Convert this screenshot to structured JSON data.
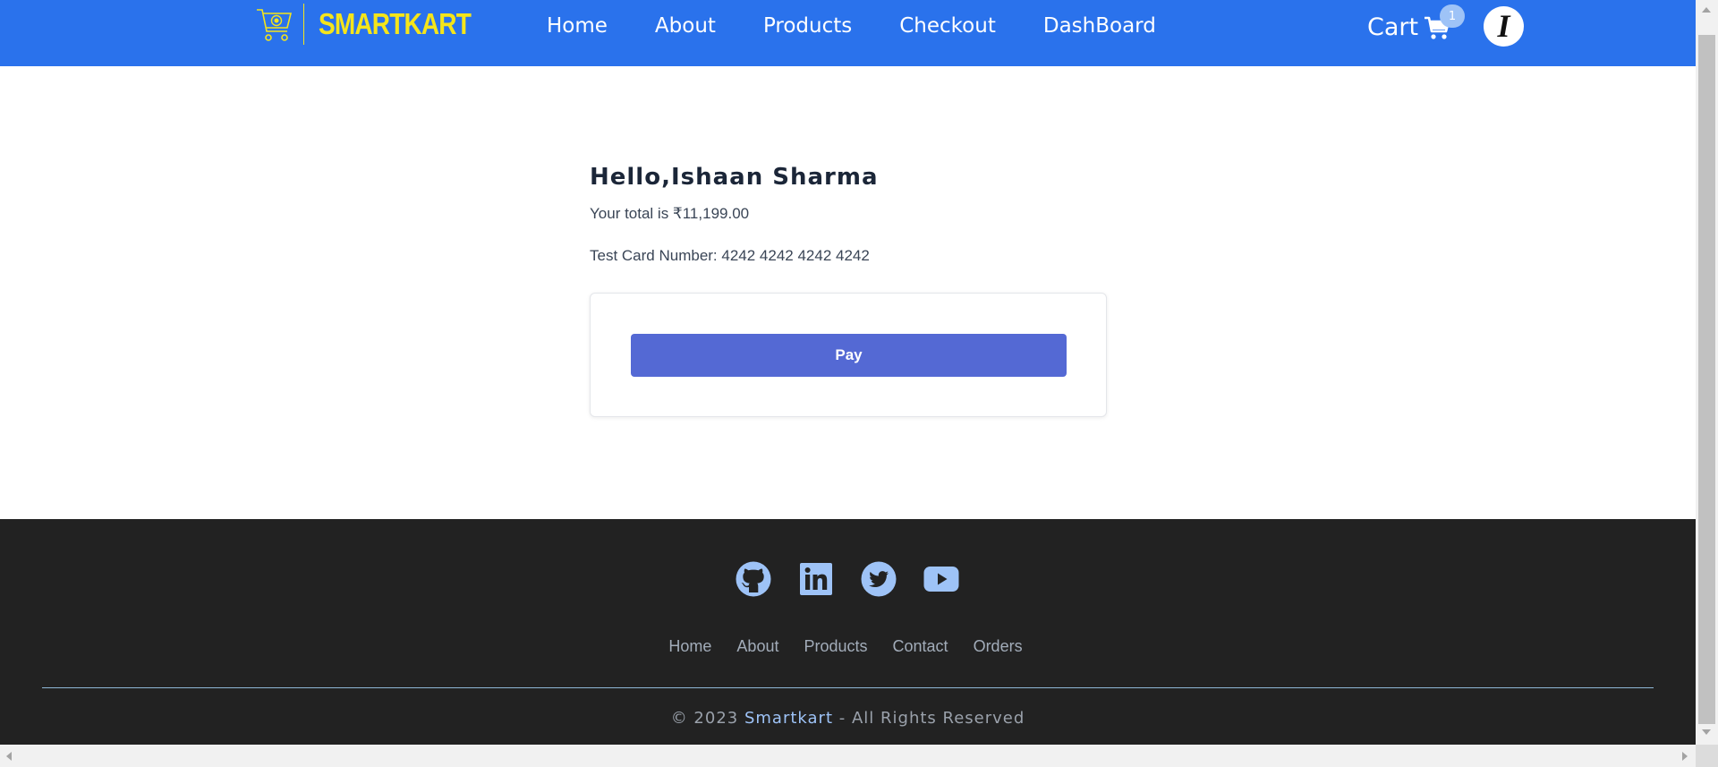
{
  "header": {
    "logo_text": "SMARTKART",
    "nav": [
      "Home",
      "About",
      "Products",
      "Checkout",
      "DashBoard"
    ],
    "cart_label": "Cart",
    "cart_count": "1",
    "avatar_initial": "I"
  },
  "main": {
    "greeting": "Hello,Ishaan Sharma",
    "total": "Your total is ₹11,199.00",
    "card_number": "Test Card Number: 4242 4242 4242 4242",
    "pay_label": "Pay"
  },
  "footer": {
    "social_icons": [
      "github-icon",
      "linkedin-icon",
      "twitter-icon",
      "youtube-icon"
    ],
    "links": [
      "Home",
      "About",
      "Products",
      "Contact",
      "Orders"
    ],
    "copyright_prefix": "© 2023",
    "copyright_brand": "Smartkart",
    "copyright_suffix": "- All Rights Reserved"
  },
  "colors": {
    "header_bg": "#2a72ec",
    "logo": "#f5e51a",
    "pay_button": "#5469d4",
    "footer_bg": "#222222",
    "social_icon": "#9ec3f7"
  }
}
